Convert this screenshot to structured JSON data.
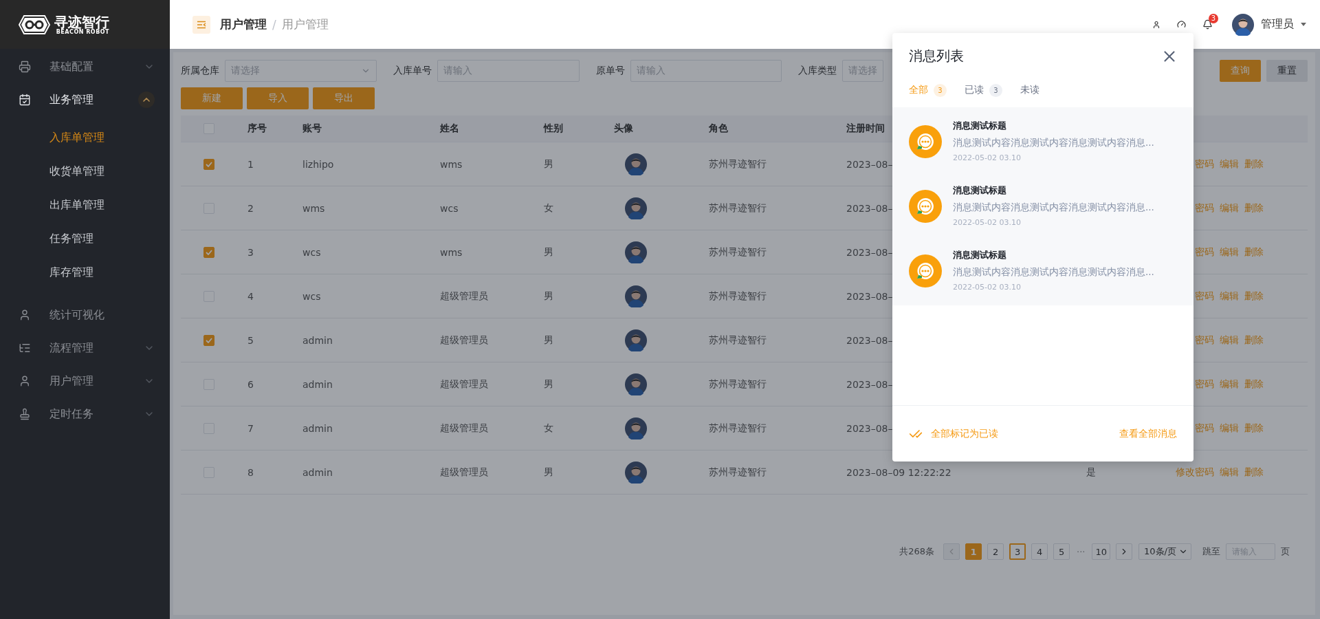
{
  "logo": {
    "name": "寻迹智行",
    "tagline": "BEACON ROBOT"
  },
  "sidebar": {
    "items": [
      {
        "label": "基础配置",
        "expandable": true,
        "expanded": false
      },
      {
        "label": "业务管理",
        "expandable": true,
        "expanded": true,
        "children": [
          {
            "label": "入库单管理",
            "selected": true
          },
          {
            "label": "收货单管理",
            "selected": false
          },
          {
            "label": "出库单管理",
            "selected": false
          },
          {
            "label": "任务管理",
            "selected": false
          },
          {
            "label": "库存管理",
            "selected": false
          }
        ]
      },
      {
        "label": "统计可视化",
        "expandable": false,
        "expanded": false
      },
      {
        "label": "流程管理",
        "expandable": true,
        "expanded": false
      },
      {
        "label": "用户管理",
        "expandable": true,
        "expanded": false
      },
      {
        "label": "定时任务",
        "expandable": true,
        "expanded": false
      }
    ]
  },
  "header": {
    "breadcrumb": [
      "用户管理",
      "用户管理"
    ],
    "breadcrumb_separator": "/",
    "notification_count": "3",
    "user": "管理员"
  },
  "filters": [
    {
      "label": "所属仓库",
      "placeholder": "请选择",
      "kind": "select"
    },
    {
      "label": "入库单号",
      "placeholder": "请输入",
      "kind": "input"
    },
    {
      "label": "原单号",
      "placeholder": "请输入",
      "kind": "input"
    },
    {
      "label": "入库类型",
      "placeholder": "请选择",
      "kind": "input"
    }
  ],
  "search_buttons": [
    "查询",
    "重置"
  ],
  "actions": [
    "新建",
    "导入",
    "导出"
  ],
  "table": {
    "header_checked": false,
    "columns": [
      "序号",
      "账号",
      "姓名",
      "性别",
      "头像",
      "角色",
      "注册时间"
    ],
    "rows": [
      {
        "checked": true,
        "index": "1",
        "account": "lizhipo",
        "name": "wms",
        "gender": "男",
        "role": "苏州寻迹智行",
        "registered": "2023–08–",
        "actions": [
          "密码",
          "编辑",
          "删除"
        ]
      },
      {
        "checked": false,
        "index": "2",
        "account": "wms",
        "name": "wcs",
        "gender": "女",
        "role": "苏州寻迹智行",
        "registered": "2023–08–",
        "actions": [
          "密码",
          "编辑",
          "删除"
        ]
      },
      {
        "checked": true,
        "index": "3",
        "account": "wcs",
        "name": "wms",
        "gender": "男",
        "role": "苏州寻迹智行",
        "registered": "2023–08–",
        "actions": [
          "密码",
          "编辑",
          "删除"
        ]
      },
      {
        "checked": false,
        "index": "4",
        "account": "wcs",
        "name": "超级管理员",
        "gender": "男",
        "role": "苏州寻迹智行",
        "registered": "2023–08–",
        "actions": [
          "密码",
          "编辑",
          "删除"
        ]
      },
      {
        "checked": true,
        "index": "5",
        "account": "admin",
        "name": "超级管理员",
        "gender": "男",
        "role": "苏州寻迹智行",
        "registered": "2023–08–",
        "actions": [
          "密码",
          "编辑",
          "删除"
        ]
      },
      {
        "checked": false,
        "index": "6",
        "account": "admin",
        "name": "超级管理员",
        "gender": "男",
        "role": "苏州寻迹智行",
        "registered": "2023–08–",
        "actions": [
          "密码",
          "编辑",
          "删除"
        ]
      },
      {
        "checked": false,
        "index": "7",
        "account": "admin",
        "name": "超级管理员",
        "gender": "女",
        "role": "苏州寻迹智行",
        "registered": "2023–08–",
        "actions": [
          "密码",
          "编辑",
          "删除"
        ]
      },
      {
        "checked": false,
        "index": "8",
        "account": "admin",
        "name": "超级管理员",
        "gender": "男",
        "role": "苏州寻迹智行",
        "registered": "2023–08–09 12:22:22",
        "status": "是",
        "actions": [
          "修改密码",
          "编辑",
          "删除"
        ]
      }
    ]
  },
  "pagination": {
    "total": "共268条",
    "pages": [
      {
        "kind": "page",
        "label": "1",
        "selected": true,
        "focused": false
      },
      {
        "kind": "page",
        "label": "2",
        "selected": false,
        "focused": false
      },
      {
        "kind": "page",
        "label": "3",
        "selected": false,
        "focused": true
      },
      {
        "kind": "page",
        "label": "4",
        "selected": false,
        "focused": false
      },
      {
        "kind": "page",
        "label": "5",
        "selected": false,
        "focused": false
      },
      {
        "kind": "ellipsis",
        "label": "···"
      },
      {
        "kind": "page",
        "label": "10",
        "selected": false,
        "focused": false
      }
    ],
    "prev_disabled": true,
    "page_size": "10条/页",
    "jump_label": "跳至",
    "jump_placeholder": "请输入",
    "page_unit": "页"
  },
  "messages_panel": {
    "title": "消息列表",
    "tabs": [
      {
        "label": "全部",
        "count": "3",
        "selected": true
      },
      {
        "label": "已读",
        "count": "3",
        "selected": false
      },
      {
        "label": "未读",
        "selected": false
      }
    ],
    "items": [
      {
        "title": "消息测试标题",
        "body": "消息测试内容消息测试内容消息测试内容消息...",
        "time": "2022-05-02 03.10"
      },
      {
        "title": "消息测试标题",
        "body": "消息测试内容消息测试内容消息测试内容消息...",
        "time": "2022-05-02 03.10"
      },
      {
        "title": "消息测试标题",
        "body": "消息测试内容消息测试内容消息测试内容消息...",
        "time": "2022-05-02 03.10"
      }
    ],
    "mark_all_read": "全部标记为已读",
    "view_all": "查看全部消息"
  }
}
